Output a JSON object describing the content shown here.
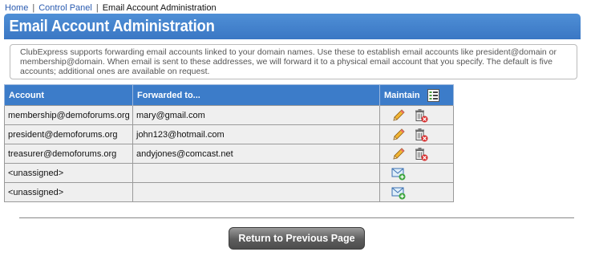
{
  "breadcrumb": {
    "home": "Home",
    "control_panel": "Control Panel",
    "current": "Email Account Administration",
    "separator": "|"
  },
  "page_title": "Email Account Administration",
  "intro_text": "ClubExpress supports forwarding email accounts linked to your domain names. Use these to establish email accounts like president@domain or membership@domain. When email is sent to these addresses, we will forward it to a physical email account that you specify. The default is five accounts; additional ones are available on request.",
  "table": {
    "headers": {
      "account": "Account",
      "forwarded": "Forwarded to...",
      "maintain": "Maintain"
    },
    "rows": [
      {
        "account": "membership@demoforums.org",
        "forwarded": "mary@gmail.com"
      },
      {
        "account": "president@demoforums.org",
        "forwarded": "john123@hotmail.com"
      },
      {
        "account": "treasurer@demoforums.org",
        "forwarded": "andyjones@comcast.net"
      },
      {
        "account": "<unassigned>",
        "forwarded": ""
      },
      {
        "account": "<unassigned>",
        "forwarded": ""
      }
    ]
  },
  "return_button": "Return to Previous Page",
  "colors": {
    "header_blue": "#3c7cc9",
    "title_blue": "#4a89d2",
    "cell_bg": "#efefef",
    "button_gray": "#5d5d5d"
  },
  "icons": {
    "header": "list-details-icon",
    "edit": "pencil-edit-icon",
    "delete": "trash-delete-icon",
    "assign": "add-email-icon"
  }
}
